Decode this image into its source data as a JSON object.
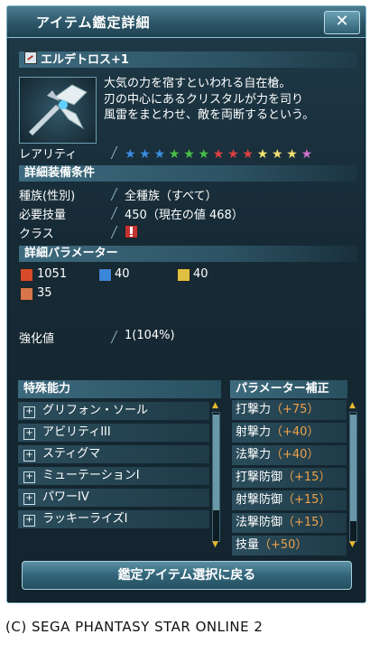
{
  "window": {
    "title": "アイテム鑑定詳細",
    "close_label": "✕"
  },
  "item": {
    "name": "エルデトロス+1",
    "description": [
      "大気の力を宿すといわれる自在槍。",
      "刃の中心にあるクリスタルが力を司り",
      "風雷をまとわせ、敵を両断するという。"
    ]
  },
  "rarity": {
    "label": "レアリティ",
    "star_colors": [
      "#3a8de0",
      "#3a8de0",
      "#3a8de0",
      "#48c048",
      "#48c048",
      "#48c048",
      "#e04040",
      "#e04040",
      "#e04040",
      "#f2e070",
      "#f2e070",
      "#f2e070",
      "#d070d0"
    ]
  },
  "requirements": {
    "header": "詳細装備条件",
    "rows": [
      {
        "label": "種族(性別)",
        "value": "全種族（すべて）"
      },
      {
        "label": "必要技量",
        "value": "450（現在の値 468）"
      },
      {
        "label": "クラス",
        "value": ""
      }
    ]
  },
  "parameters": {
    "header": "詳細パラメーター",
    "stats": [
      {
        "icon": "melee-attack-icon",
        "value": "1051"
      },
      {
        "icon": "ranged-attack-icon",
        "value": "40"
      },
      {
        "icon": "technique-attack-icon",
        "value": "40"
      },
      {
        "icon": "dexterity-icon",
        "value": "35"
      }
    ]
  },
  "grind": {
    "label": "強化値",
    "value": "1(104%)"
  },
  "special_abilities": {
    "header": "特殊能力",
    "items": [
      "グリフォン・ソール",
      "アビリティIII",
      "スティグマ",
      "ミューテーションI",
      "パワーIV",
      "ラッキーライズI"
    ]
  },
  "param_bonus": {
    "header": "パラメーター補正",
    "items": [
      {
        "name": "打撃力",
        "bonus": "（+75）"
      },
      {
        "name": "射撃力",
        "bonus": "（+40）"
      },
      {
        "name": "法撃力",
        "bonus": "（+40）"
      },
      {
        "name": "打撃防御",
        "bonus": "（+15）"
      },
      {
        "name": "射撃防御",
        "bonus": "（+15）"
      },
      {
        "name": "法撃防御",
        "bonus": "（+15）"
      },
      {
        "name": "技量",
        "bonus": "（+50）"
      }
    ]
  },
  "back_button": "鑑定アイテム選択に戻る",
  "copyright": "(C)  SEGA   PHANTASY STAR ONLINE 2"
}
